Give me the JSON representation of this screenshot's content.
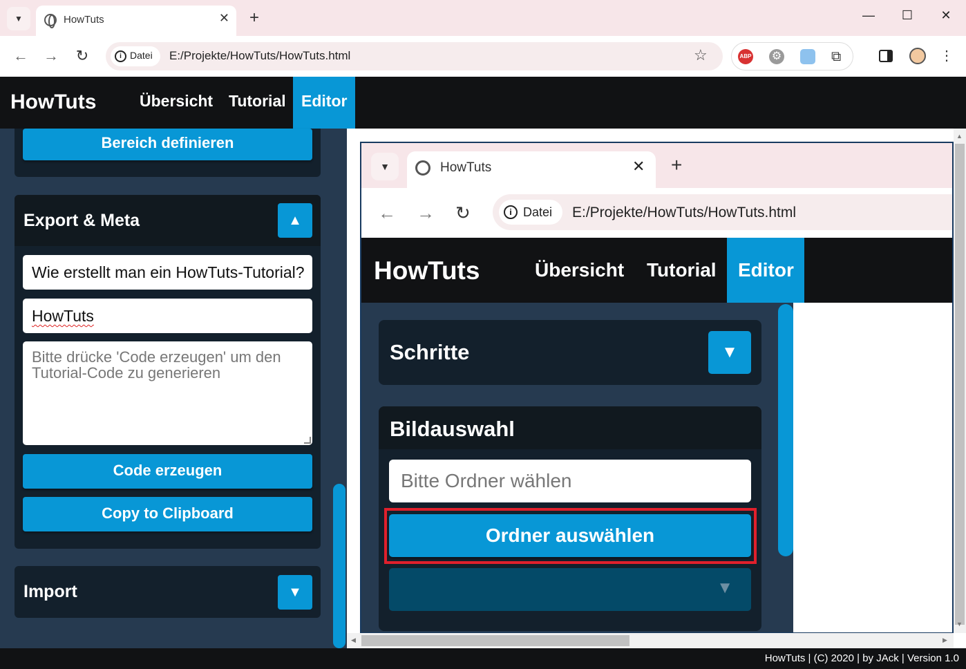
{
  "browser": {
    "tab_title": "HowTuts",
    "tab_close": "✕",
    "new_tab": "+",
    "window_controls": [
      "—",
      "☐",
      "✕"
    ],
    "site_chip": "Datei",
    "url": "E:/Projekte/HowTuts/HowTuts.html",
    "extensions": [
      "ABP",
      "gear-extension",
      "cloud-extension",
      "puzzle-icon"
    ]
  },
  "app": {
    "brand": "HowTuts",
    "nav": [
      "Übersicht",
      "Tutorial",
      "Editor"
    ],
    "active_nav": "Editor",
    "accent": "#0897d6",
    "footer": "HowTuts | (C) 2020 | by JAck | Version 1.0"
  },
  "sidebar": {
    "define_area_button": "Bereich definieren",
    "export_meta": {
      "title": "Export & Meta",
      "title_value": "Wie erstellt man ein HowTuts-Tutorial?",
      "author_value": "HowTuts",
      "code_placeholder": "Bitte drücke 'Code erzeugen' um den Tutorial-Code zu generieren",
      "generate_button": "Code erzeugen",
      "copy_button": "Copy to Clipboard"
    },
    "import": {
      "title": "Import"
    }
  },
  "embedded": {
    "tab_title": "HowTuts",
    "site_chip": "Datei",
    "url": "E:/Projekte/HowTuts/HowTuts.html",
    "brand": "HowTuts",
    "nav": [
      "Übersicht",
      "Tutorial",
      "Editor"
    ],
    "steps_title": "Schritte",
    "image_select_title": "Bildauswahl",
    "folder_placeholder": "Bitte Ordner wählen",
    "folder_button": "Ordner auswählen"
  }
}
